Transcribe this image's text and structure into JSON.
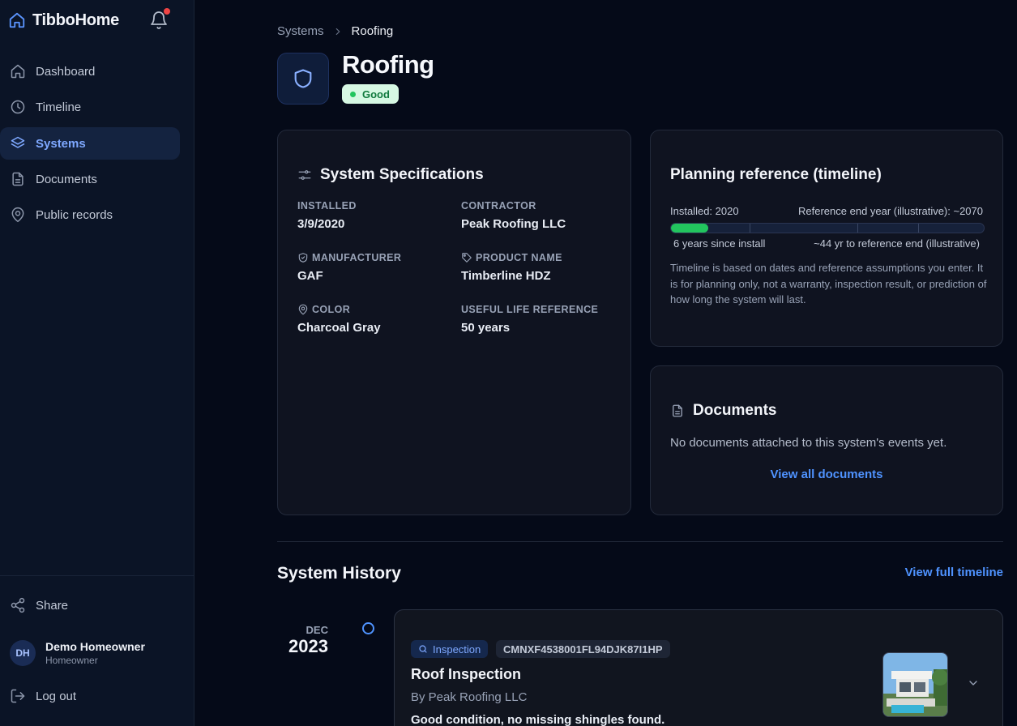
{
  "app": {
    "name": "TibboHome"
  },
  "sidebar": {
    "items": [
      {
        "label": "Dashboard",
        "icon": "home-icon"
      },
      {
        "label": "Timeline",
        "icon": "clock-icon"
      },
      {
        "label": "Systems",
        "icon": "layers-icon",
        "active": true
      },
      {
        "label": "Documents",
        "icon": "document-icon"
      },
      {
        "label": "Public records",
        "icon": "map-pin-icon"
      }
    ],
    "share_label": "Share",
    "user": {
      "initials": "DH",
      "name": "Demo Homeowner",
      "role": "Homeowner"
    },
    "logout_label": "Log out"
  },
  "breadcrumb": {
    "parent": "Systems",
    "current": "Roofing"
  },
  "page": {
    "title": "Roofing",
    "status": "Good"
  },
  "specs": {
    "title": "System Specifications",
    "items": [
      {
        "label": "INSTALLED",
        "value": "3/9/2020"
      },
      {
        "label": "CONTRACTOR",
        "value": "Peak Roofing LLC"
      },
      {
        "label": "MANUFACTURER",
        "value": "GAF",
        "icon": "shield-check-icon"
      },
      {
        "label": "PRODUCT NAME",
        "value": "Timberline HDZ",
        "icon": "tag-icon"
      },
      {
        "label": "COLOR",
        "value": "Charcoal Gray",
        "icon": "map-pin-icon"
      },
      {
        "label": "USEFUL LIFE REFERENCE",
        "value": "50 years"
      }
    ]
  },
  "planning": {
    "title": "Planning reference (timeline)",
    "installed": "Installed: 2020",
    "end": "Reference end year (illustrative): ~2070",
    "since": "6 years since install",
    "remaining": "~44 yr to reference end (illustrative)",
    "progress_fraction": 0.12,
    "note": "Timeline is based on dates and reference assumptions you enter. It is for planning only, not a warranty, inspection result, or prediction of how long the system will last."
  },
  "documents": {
    "title": "Documents",
    "empty": "No documents attached to this system's events yet.",
    "link": "View all documents"
  },
  "history": {
    "title": "System History",
    "link": "View full timeline",
    "events": [
      {
        "month": "DEC",
        "year": "2023",
        "type": "Inspection",
        "id": "CMNXF4538001FL94DJK87I1HP",
        "title": "Roof Inspection",
        "by": "By Peak Roofing LLC",
        "description": "Good condition, no missing shingles found."
      }
    ]
  },
  "colors": {
    "accent": "#4f93ff",
    "good": "#22c55e",
    "background": "#050a18"
  }
}
